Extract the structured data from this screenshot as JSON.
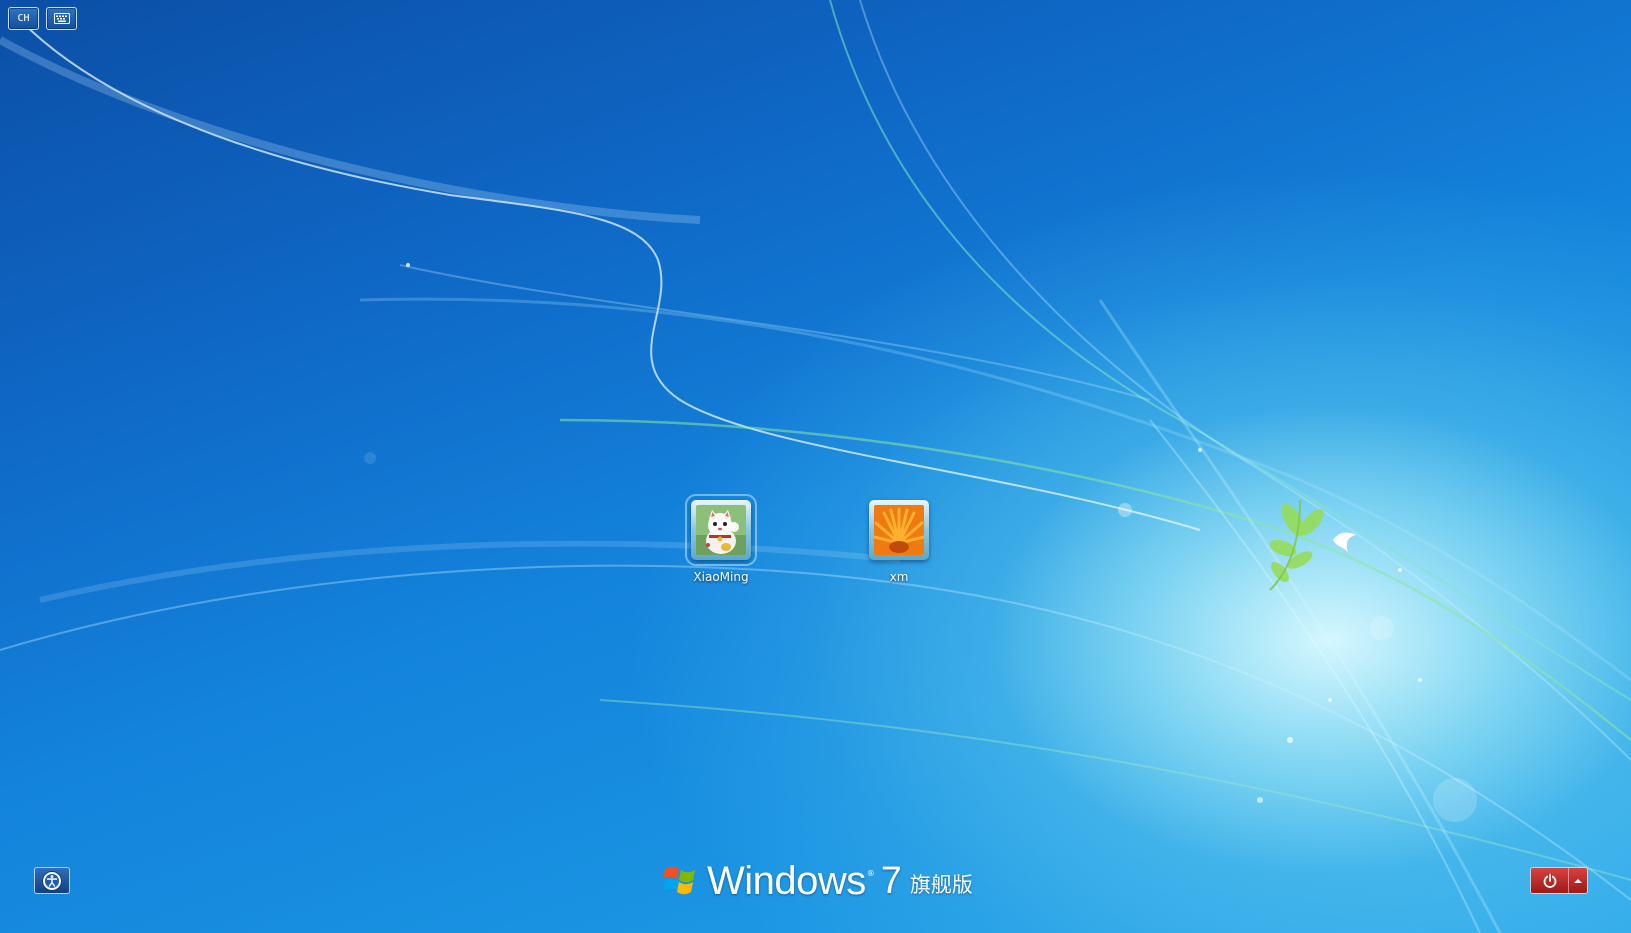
{
  "screen": {
    "title": "Windows 7 logon screen"
  },
  "top_left": {
    "language_label": "CH",
    "keyboard_icon": "keyboard-icon"
  },
  "users": [
    {
      "name": "XiaoMing",
      "picture": "lucky-cat-picture",
      "selected": true
    },
    {
      "name": "xm",
      "picture": "orange-flower-picture",
      "selected": false
    }
  ],
  "bottom_left": {
    "ease_of_access_icon": "ease-of-access-icon"
  },
  "branding": {
    "product": "Windows",
    "registered": "®",
    "version": "7",
    "edition": "旗舰版"
  },
  "bottom_right": {
    "power_icon": "power-icon",
    "options_icon": "chevron-up-icon",
    "power_color": "#b8231f"
  },
  "colors": {
    "background_dark": "#0b4fa6",
    "background_light": "#2aa6ea",
    "glow": "#dcfaff"
  }
}
